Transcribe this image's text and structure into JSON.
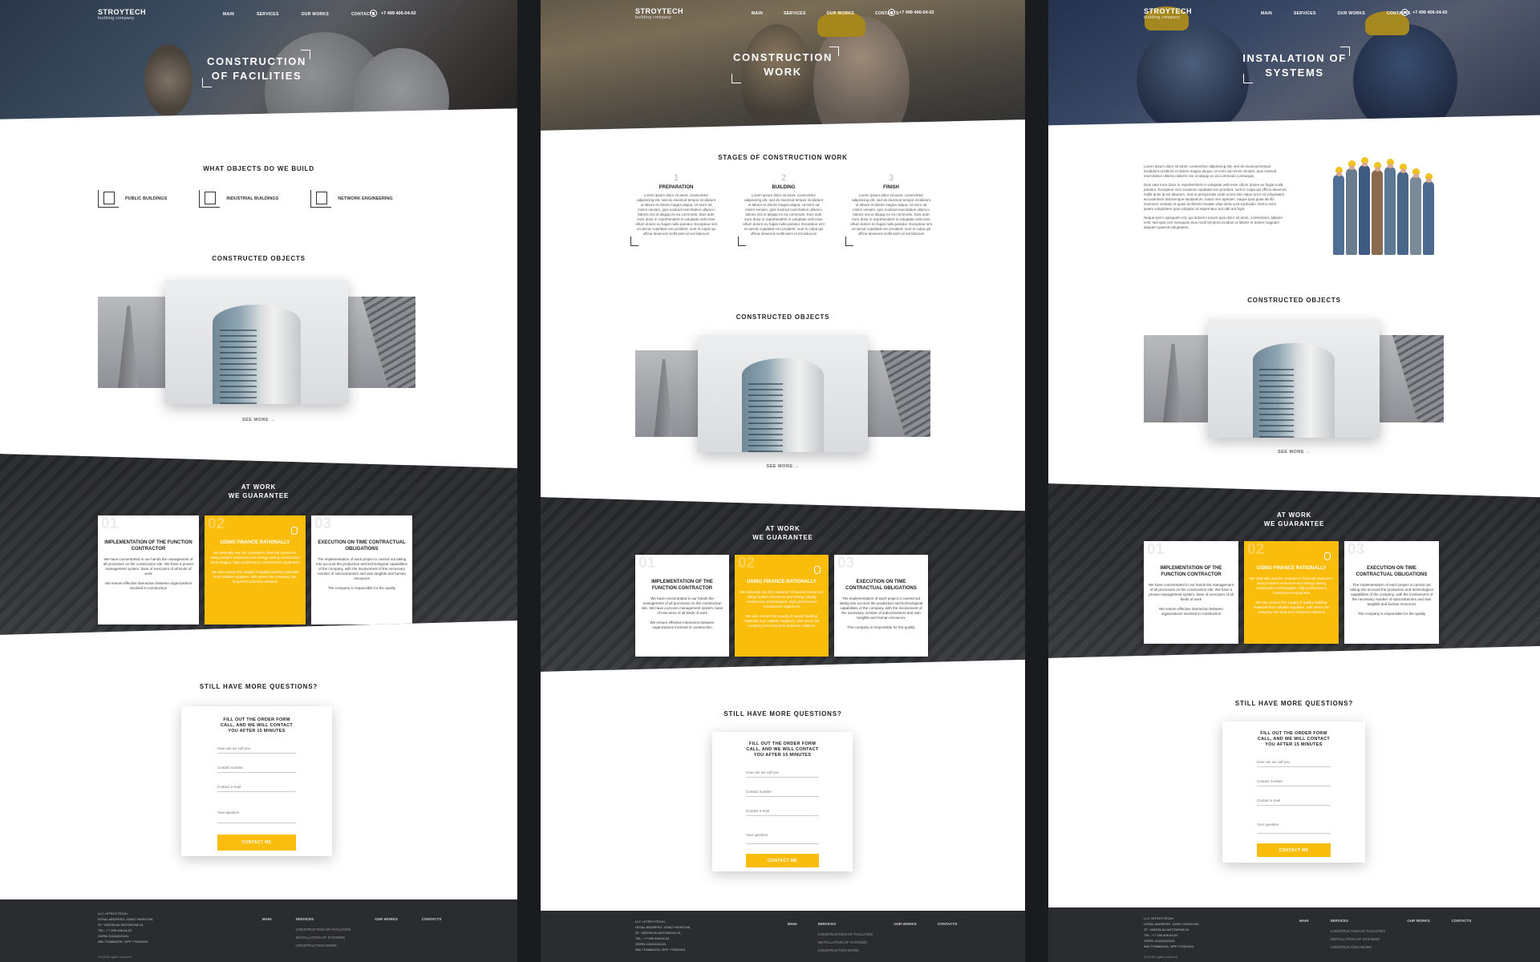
{
  "brand": {
    "name": "STROYTECH",
    "sub": "building company"
  },
  "nav": [
    "MAIN",
    "SERVICES",
    "OUR WORKS",
    "CONTACTS"
  ],
  "phone": "+7 499 406-04-02",
  "pages": [
    {
      "hero_title": "CONSTRUCTION OF FACILITIES"
    },
    {
      "hero_title": "CONSTRUCTION WORK"
    },
    {
      "hero_title": "INSTALATION OF SYSTEMS"
    }
  ],
  "objects": {
    "title": "WHAT OBJECTS DO WE BUILD",
    "items": [
      "PUBLIC BUILDINGS",
      "INDUSTRIAL BUILDINGS",
      "NETWORK ENGINEERING"
    ]
  },
  "stages": {
    "title": "STAGES OF CONSTRUCTION WORK",
    "items": [
      {
        "num": "1",
        "title": "PREPARATION"
      },
      {
        "num": "2",
        "title": "BUILDING"
      },
      {
        "num": "3",
        "title": "FINISH"
      }
    ],
    "text": "Lorem ipsum dolor sit amet, consectetur adipisicing elit, sed do eiusmod tempor incididunt ut labore et dolore magna aliqua. Ut enim ad minim veniam, quis nostrud exercitation ullamco laboris nisi ut aliquip ex ea commodo. Duis aute irure dolor in reprehenderit in voluptate velit esse cillum dolore eu fugiat nulla pariatur. Excepteur sint occaecat cupidatat non proident, sunt in culpa qui officia deserunt mollit anim id est laborum"
  },
  "about": {
    "p1": "Lorem ipsum dolor sit amet, consectetur adipisicing elit, sed do eiusmod tempor incididunt ut labore et dolore magna aliqua. Ut enim ad minim veniam, quis nostrud exercitation ullamco laboris nisi ut aliquip ex ea commodo consequat.",
    "p2": "Duis aute irure dolor in reprehenderit in voluptate velit esse cillum dolore eu fugiat nulla pariatur. Excepteur sint occaecat cupidatat non proident, sunt in culpa qui officia deserunt mollit anim id est laborum. Sed ut perspiciatis unde omnis iste natus error sit voluptatem accusantium doloremque laudantium, totam rem aperiam, eaque ipsa quae ab illo inventore veritatis et quasi architecto beatae vitae dicta sunt explicabo. Nemo enim ipsam voluptatem quia voluptas sit aspernatur aut odit aut fugit.",
    "p3": "Neque porro quisquam est, qui dolorem ipsum quia dolor sit amet, consectetur, adipisci velit, sed quia non numquam eius modi tempora incidunt ut labore et dolore magnam aliquam quaerat voluptatem."
  },
  "constructed": {
    "title": "CONSTRUCTED OBJECTS",
    "see_more": "SEE MORE"
  },
  "guarantee": {
    "title1": "AT WORK",
    "title2": "WE GUARANTEE",
    "cards": [
      {
        "num": "01",
        "title": "IMPLEMENTATION OF THE FUNCTION CONTRACTOR",
        "text1": "We have concentrated in our hands the management of all processes on the construction site. We have a proven management system, base of executors of all kinds of work",
        "text2": "We ensure effective interaction between organizations involved in construction"
      },
      {
        "num": "02",
        "title": "USING FINANCE RATIONALLY",
        "text1": "We rationally use the customer's financial resources, using modern resources and energy saving construction technologies, high performance construction equipment",
        "text2": "We also ensure the supply of quality building materials from reliable suppliers, with whom the company has long-term business relations"
      },
      {
        "num": "03",
        "title": "EXECUTION ON TIME CONTRACTUAL OBLIGATIONS",
        "text1": "The implementation of each project is carried out taking into account the production and technological capabilities of the company, with the involvement of the necessary number of subcontractors and own tangible and human resources",
        "text2": "The company is responsible for the quality"
      }
    ]
  },
  "questions": {
    "title": "STILL HAVE MORE QUESTIONS?",
    "form_title": "FILL OUT THE ORDER FORM CALL, AND WE WILL CONTACT YOU AFTER 15 MINUTES",
    "name_ph": "How can we call you",
    "number_ph": "Contact number",
    "email_ph": "Contact e-mail",
    "question_ph": "Your question",
    "button": "CONTACT ME"
  },
  "footer": {
    "company": "LLC «STROYTECH»",
    "address": "LEGAL ADDRESS: 115517 MOSCOW,",
    "street": "ST. YAROSLAV ANTONOVA 15,",
    "tel": "TEL.: +7 499 406-04-02",
    "ogrn": "OGRN 1111111111111",
    "inn": "INN 7703684076 / KPP 770301001",
    "copyright": "2018 All rights reserved",
    "main": "MAIN",
    "services": "SERVICES",
    "works": "OUR WORKS",
    "contacts": "CONTACTS",
    "service_links": [
      "CONSTRUCTION OF FACILITIES",
      "INSTALLATION OF SYSTEMS",
      "CONSTRUCTION WORK"
    ]
  },
  "colors": {
    "accent": "#fbbd0b",
    "dark": "#2b2c2f",
    "outer_bg": "#1a1b1e"
  }
}
